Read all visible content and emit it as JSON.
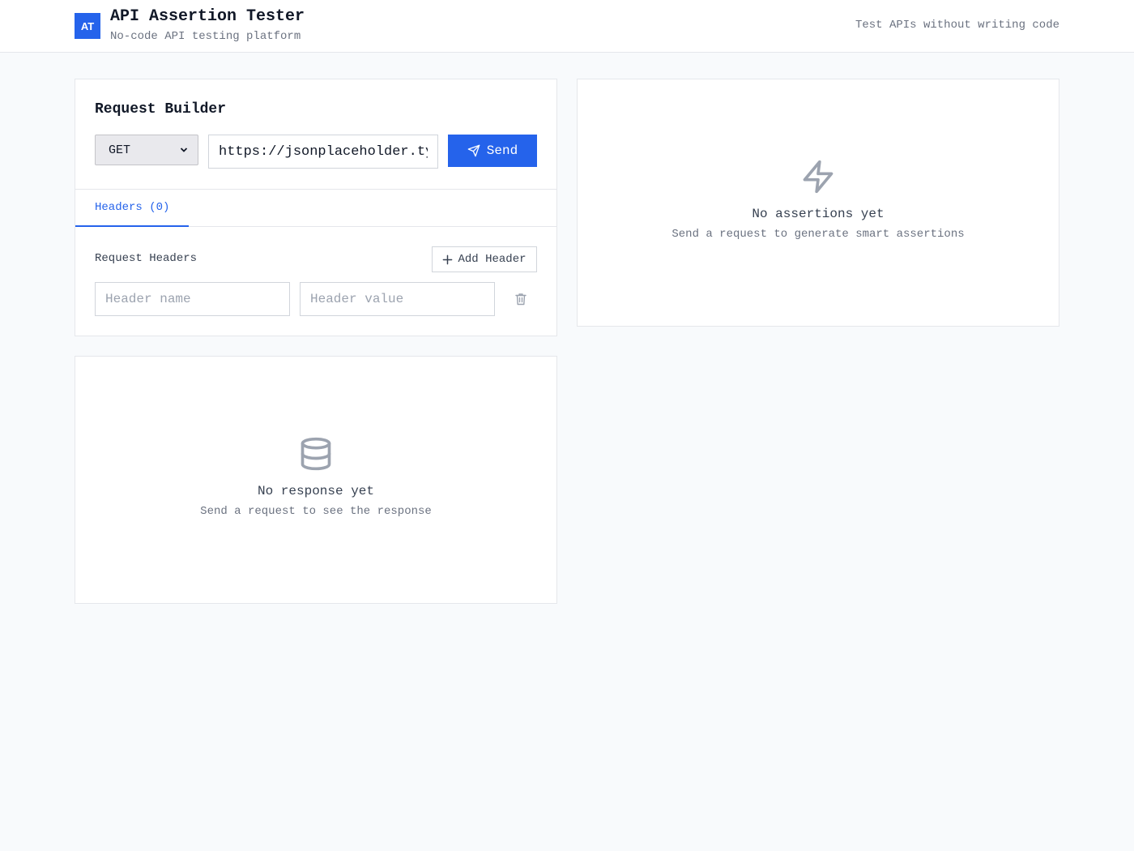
{
  "header": {
    "logo_text": "AT",
    "title": "API Assertion Tester",
    "subtitle": "No-code API testing platform",
    "tagline": "Test APIs without writing code"
  },
  "request_builder": {
    "title": "Request Builder",
    "method": "GET",
    "url": "https://jsonplaceholder.typ",
    "send_label": "Send",
    "tabs": [
      {
        "label": "Headers (0)",
        "active": true
      }
    ],
    "headers_section": {
      "label": "Request Headers",
      "add_label": "Add Header",
      "name_placeholder": "Header name",
      "value_placeholder": "Header value"
    }
  },
  "assertions": {
    "empty_title": "No assertions yet",
    "empty_sub": "Send a request to generate smart assertions",
    "icon": "zap-icon"
  },
  "response": {
    "empty_title": "No response yet",
    "empty_sub": "Send a request to see the response",
    "icon": "database-icon"
  },
  "colors": {
    "accent": "#2563eb",
    "background": "#f8fafc",
    "muted": "#6b7280",
    "icon_gray": "#9ca3af"
  }
}
